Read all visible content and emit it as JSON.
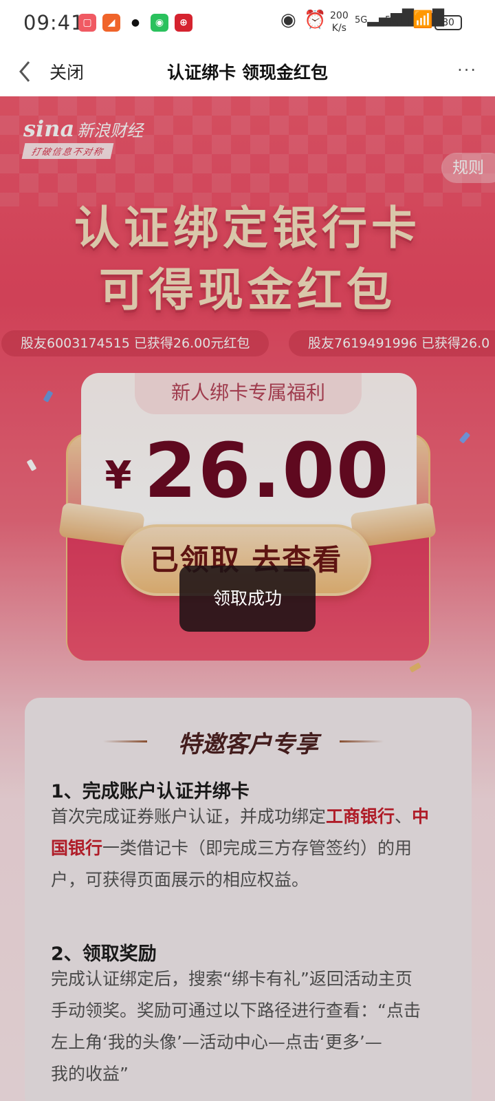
{
  "status_bar": {
    "time": "09:41",
    "net_speed_value": "200",
    "net_speed_unit": "K/s",
    "sim1": "5G",
    "sim2": "5G",
    "battery": "80",
    "app_icons": [
      "red-app-icon",
      "orange-app-icon",
      "qq-icon",
      "wechat-icon",
      "bank-app-icon"
    ]
  },
  "nav": {
    "close_label": "关闭",
    "title": "认证绑卡 领现金红包",
    "more_label": "···"
  },
  "hero": {
    "brand_name": "新浪财经",
    "brand_mark": "sina",
    "brand_slogan": "打破信息不对称",
    "rules_label": "规则",
    "headline_line1": "认证绑定银行卡",
    "headline_line2": "可得现金红包",
    "ticker": [
      "股友6003174515 已获得26.00元红包",
      "股友7619491996 已获得26.0"
    ]
  },
  "packet": {
    "tab_label": "新人绑卡专属福利",
    "currency": "¥",
    "amount": "26.00",
    "claim_button": "已领取 去查看"
  },
  "toast": {
    "message": "领取成功"
  },
  "info": {
    "title": "特邀客户专享",
    "section1_title": "1、完成账户认证并绑卡",
    "section1_text_a": "首次完成证券账户认证，并成功绑定",
    "section1_bank1": "工商银行",
    "section1_sep": "、",
    "section1_bank2_a": "中",
    "section1_bank2_b": "国银行",
    "section1_text_b": "一类借记卡（即完成三方存管签约）的用",
    "section1_text_c": "户，可获得页面展示的相应权益。",
    "section2_title": "2、领取奖励",
    "section2_line1": "完成认证绑定后，搜索“绑卡有礼”返回活动主页",
    "section2_line2": "手动领奖。奖励可通过以下路径进行查看：“点击",
    "section2_line3": "左上角‘我的头像’—活动中心—点击‘更多’—",
    "section2_line4": "我的收益”"
  },
  "colors": {
    "hero_red": "#ec4a63",
    "headline_gold": "#f7e3c2",
    "amount_color": "#6d0b24",
    "highlight_red": "#c8202e"
  }
}
